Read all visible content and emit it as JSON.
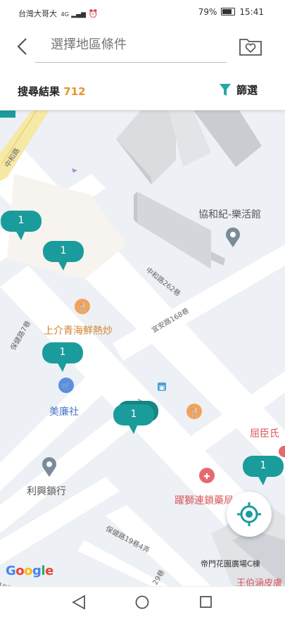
{
  "status": {
    "carrier": "台灣大哥大",
    "network": "4G",
    "battery": "79%",
    "time": "15:41"
  },
  "header": {
    "search_placeholder": "選擇地區條件"
  },
  "results": {
    "label": "搜尋結果",
    "count": "712",
    "filter_label": "篩選"
  },
  "map": {
    "places": {
      "xiehe": "協和紀-樂活館",
      "shangjie": "上介青海鮮熱炒",
      "meilian": "美廉社",
      "lixing": "利興鎖行",
      "yaoshi": "躍獅連鎖藥局",
      "quchen": "屈臣氏",
      "dimen": "帝門花園廣場C棟",
      "wangbo": "王伯涵皮膚"
    },
    "streets": {
      "zhonghe_road": "中和路",
      "zhonghe_262": "中和路262巷",
      "yian_168": "宜安路168巷",
      "baojian_7": "保健路7巷",
      "yian_road": "宜安路",
      "baojian_19_4": "保健路19巷4弄",
      "baojian_29": "29巷",
      "baojian_19_edge": "19巷"
    },
    "clusters": [
      "1",
      "1",
      "1",
      "1",
      "1"
    ],
    "attribution": "Google",
    "colors": {
      "cluster": "#1b9c9c",
      "accent": "#e8932b",
      "filter": "#26a6a6"
    }
  },
  "icons": [
    "back-arrow-icon",
    "favorite-folder-icon",
    "filter-funnel-icon",
    "locate-me-icon",
    "nav-back-icon",
    "nav-home-icon",
    "nav-recents-icon"
  ]
}
